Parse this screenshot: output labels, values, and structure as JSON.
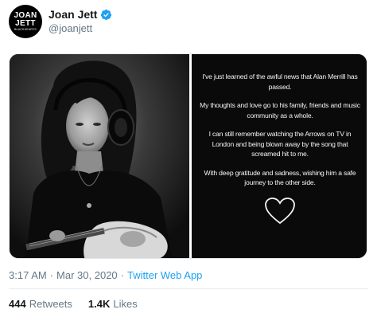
{
  "header": {
    "avatar_text_line1": "JOAN",
    "avatar_text_line2": "JETT",
    "avatar_text_line3": "BLACKHEARTS",
    "display_name": "Joan Jett",
    "handle": "@joanjett",
    "verified_icon": "verified-badge-icon",
    "verified_color": "#1da1f2"
  },
  "media": {
    "photo_alt": "black-and-white photo of a musician with headphones holding a guitar",
    "paragraphs": [
      "I've just learned of the awful news that Alan Merrill has passed.",
      "My thoughts and love go to his family, friends and music community as a whole.",
      "I can still remember watching the Arrows on TV in London and being blown away by the song that screamed hit to me.",
      "With deep gratitude and sadness, wishing him a safe journey to the other side."
    ],
    "heart_icon": "heart-outline-icon"
  },
  "meta": {
    "time": "3:17 AM",
    "separator": "·",
    "date": "Mar 30, 2020",
    "separator2": "·",
    "source": "Twitter Web App"
  },
  "stats": {
    "retweets_count": "444",
    "retweets_label": "Retweets",
    "likes_count": "1.4K",
    "likes_label": "Likes"
  },
  "colors": {
    "link": "#1da1f2",
    "secondary_text": "#657786",
    "primary_text": "#14171a"
  }
}
